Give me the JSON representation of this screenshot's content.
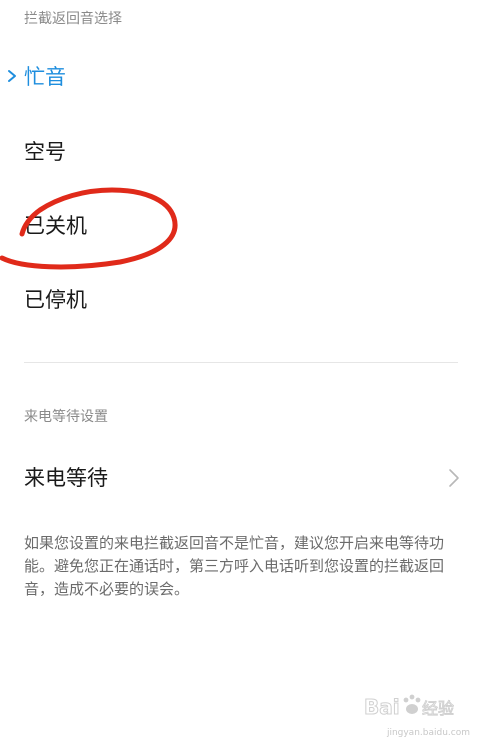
{
  "reply_section": {
    "header": "拦截返回音选择",
    "options": [
      {
        "label": "忙音",
        "selected": true
      },
      {
        "label": "空号",
        "selected": false
      },
      {
        "label": "已关机",
        "selected": false
      },
      {
        "label": "已停机",
        "selected": false
      }
    ]
  },
  "wait_section": {
    "header": "来电等待设置",
    "row_label": "来电等待",
    "description": "如果您设置的来电拦截返回音不是忙音，建议您开启来电等待功能。避免您正在通话时，第三方呼入电话听到您设置的拦截返回音，造成不必要的误会。"
  },
  "watermark": {
    "brand": "Baidu经验",
    "url": "jingyan.baidu.com"
  },
  "colors": {
    "accent": "#1e8ede",
    "annotation": "#e02a1a",
    "secondary_text": "#8a8a8a"
  },
  "icons": {
    "selected_marker": "check-icon",
    "row_arrow": "chevron-right-icon"
  }
}
